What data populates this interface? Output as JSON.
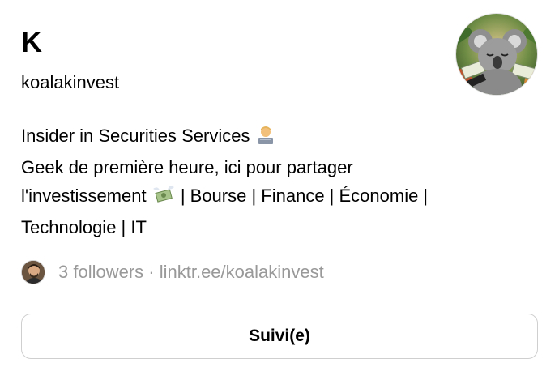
{
  "profile": {
    "display_name": "K",
    "username": "koalakinvest",
    "avatar_icon": "koala-avatar-icon"
  },
  "bio": {
    "line1_text": "Insider in Securities Services ",
    "line1_emoji": "technologist-icon",
    "line2_text": "Geek de première heure, ici pour partager",
    "line3_text_a": "l'investissement ",
    "line3_emoji": "money-with-wings-icon",
    "line3_text_b": " | Bourse | Finance | Économie |",
    "line4_text": "Technologie | IT"
  },
  "followers": {
    "count_text": "3 followers",
    "separator": " · ",
    "link_text": "linktr.ee/koalakinvest"
  },
  "follow_button": {
    "label": "Suivi(e)"
  },
  "colors": {
    "text": "#000000",
    "muted": "#999999",
    "border": "#cfcfcf"
  }
}
